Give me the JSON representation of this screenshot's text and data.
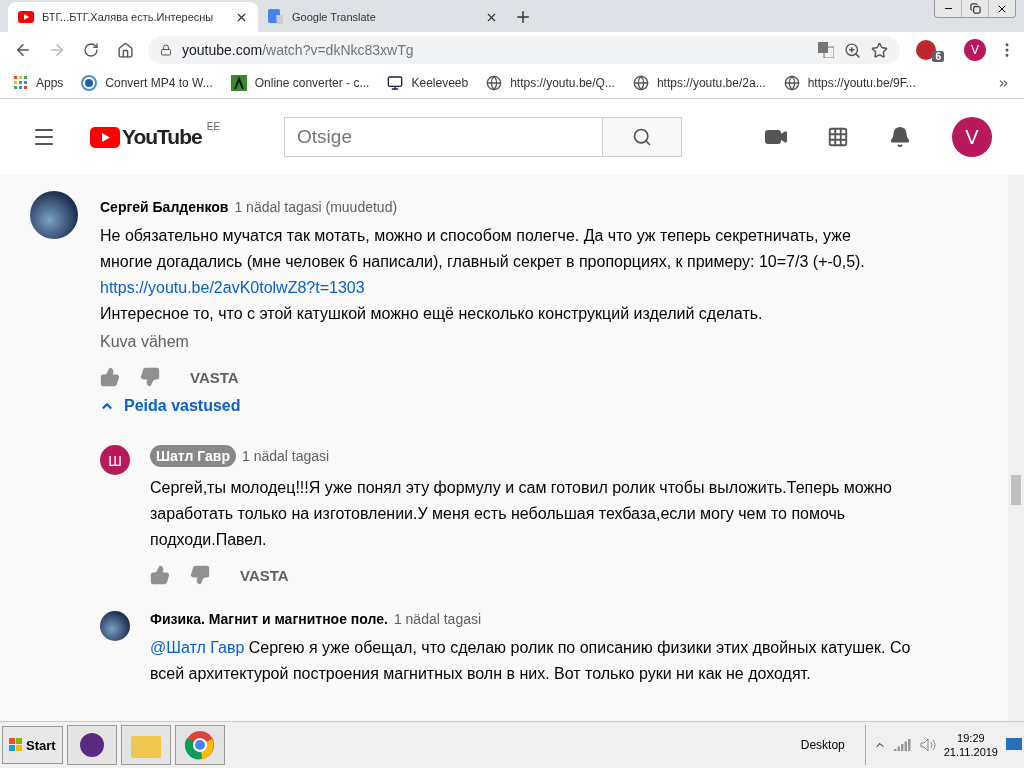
{
  "browser": {
    "tabs": [
      {
        "title": "БТГ...БТГ.Халява есть.Интересны",
        "selected": true
      },
      {
        "title": "Google Translate",
        "selected": false
      }
    ],
    "url_host": "youtube.com",
    "url_path": "/watch?v=dkNkc83xwTg",
    "extension_badge": "6",
    "profile_initial": "V",
    "bookmarks": [
      {
        "label": "Apps",
        "kind": "apps"
      },
      {
        "label": "Convert MP4 to W...",
        "kind": "converter"
      },
      {
        "label": "Online converter - c...",
        "kind": "converter"
      },
      {
        "label": "Keeleveeb",
        "kind": "site"
      },
      {
        "label": "https://youtu.be/Q...",
        "kind": "link"
      },
      {
        "label": "https://youtu.be/2a...",
        "kind": "link"
      },
      {
        "label": "https://youtu.be/9F...",
        "kind": "link"
      }
    ]
  },
  "header": {
    "logo": "YouTube",
    "region": "EE",
    "search_placeholder": "Otsige",
    "avatar_initial": "V"
  },
  "comments": [
    {
      "author": "Сергей Балденков",
      "author_badge": false,
      "time": "1 nädal tagasi (muudetud)",
      "reply": false,
      "body": [
        {
          "kind": "text",
          "text": "Не обязательно мучатся так мотать, можно и способом полегче. Да что уж теперь секретничать, уже многие догадались (мне человек 6 написали), главный секрет в пропорциях, к примеру: 10=7/3 (+-0,5)."
        },
        {
          "kind": "link",
          "text": "https://youtu.be/2avK0tolwZ8?t=1303"
        },
        {
          "kind": "text",
          "text": "Интересное то, что с этой катушкой можно ещё несколько конструкций изделий сделать."
        }
      ],
      "more": "Kuva vähem",
      "action": "VASTA",
      "replies_toggle": "Peida vastused"
    },
    {
      "author": "Шатл Гавр",
      "author_badge": true,
      "time": "1 nädal tagasi",
      "avatar_letter": "Ш",
      "reply": true,
      "body": [
        {
          "kind": "text",
          "text": "Сергей,ты молодец!!!Я уже понял эту формулу и сам готовил ролик чтобы выложить.Теперь можно заработать только на изготовлении.У меня есть небольшая техбаза,если могу чем то помочь подходи.Павел."
        }
      ],
      "action": "VASTA"
    },
    {
      "author": "Физика. Магнит и магнитное поле.",
      "author_badge": false,
      "time": "1 nädal tagasi",
      "reply": true,
      "body": [
        {
          "kind": "mention",
          "mention": "@Шатл Гавр",
          "text": " Сергею я уже обещал, что сделаю ролик по описанию физики этих двойных катушек. Со всей архитектурой построения магнитных волн в них. Вот только руки ни как не доходят."
        }
      ]
    }
  ],
  "taskbar": {
    "start": "Start",
    "desktop": "Desktop",
    "time": "19:29",
    "date": "21.11.2019"
  }
}
